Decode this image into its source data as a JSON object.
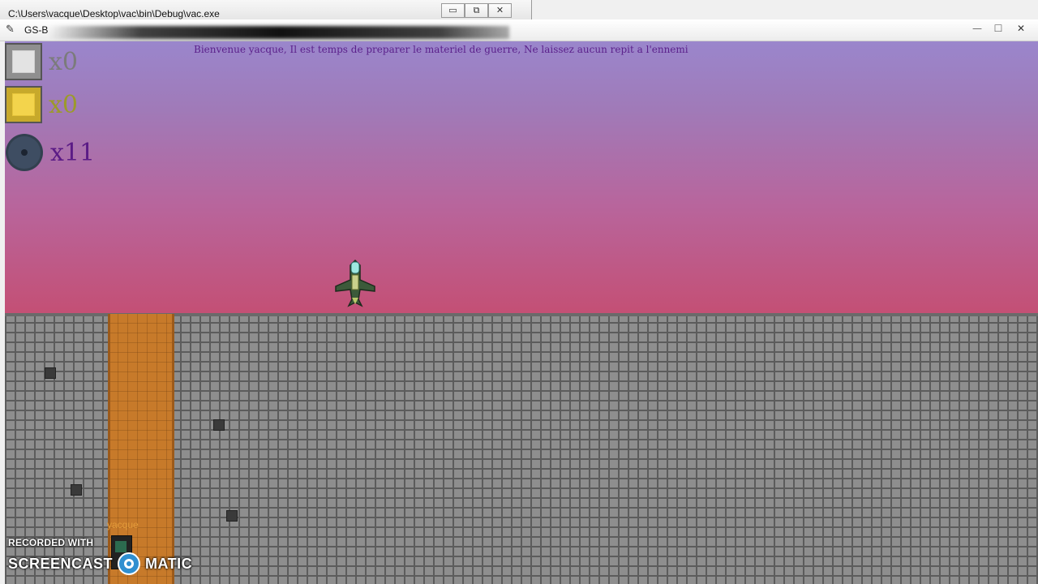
{
  "console_window": {
    "title": "C:\\Users\\vacque\\Desktop\\vac\\bin\\Debug\\vac.exe",
    "buttons": {
      "minimize": "▭",
      "restore": "⧉",
      "close": "✕"
    }
  },
  "game_window": {
    "title": "GS-B",
    "buttons": {
      "minimize": "—",
      "maximize": "☐",
      "close": "✕"
    },
    "icons": {
      "app": "pencil-icon"
    }
  },
  "hud": {
    "message": "Bienvenue yacque, Il est temps de preparer le materiel de guerre, Ne laissez aucun repit a l'ennemi",
    "inventory": [
      {
        "item": "silver-block",
        "count": "x0",
        "color": "#7b7b7b"
      },
      {
        "item": "gold-block",
        "count": "x0",
        "color": "#9c9a2a"
      },
      {
        "item": "gear",
        "count": "x11",
        "color": "#5b1b86"
      }
    ]
  },
  "player": {
    "name": "yacque"
  },
  "colors": {
    "sky_top": "#9a86cc",
    "sky_bottom": "#c44f74",
    "ground": "#8e8e8e",
    "shaft": "#c77a2a",
    "message": "#5a1f8a"
  },
  "watermark": {
    "line1": "RECORDED WITH",
    "left": "SCREENCAST",
    "right": "MATIC"
  }
}
